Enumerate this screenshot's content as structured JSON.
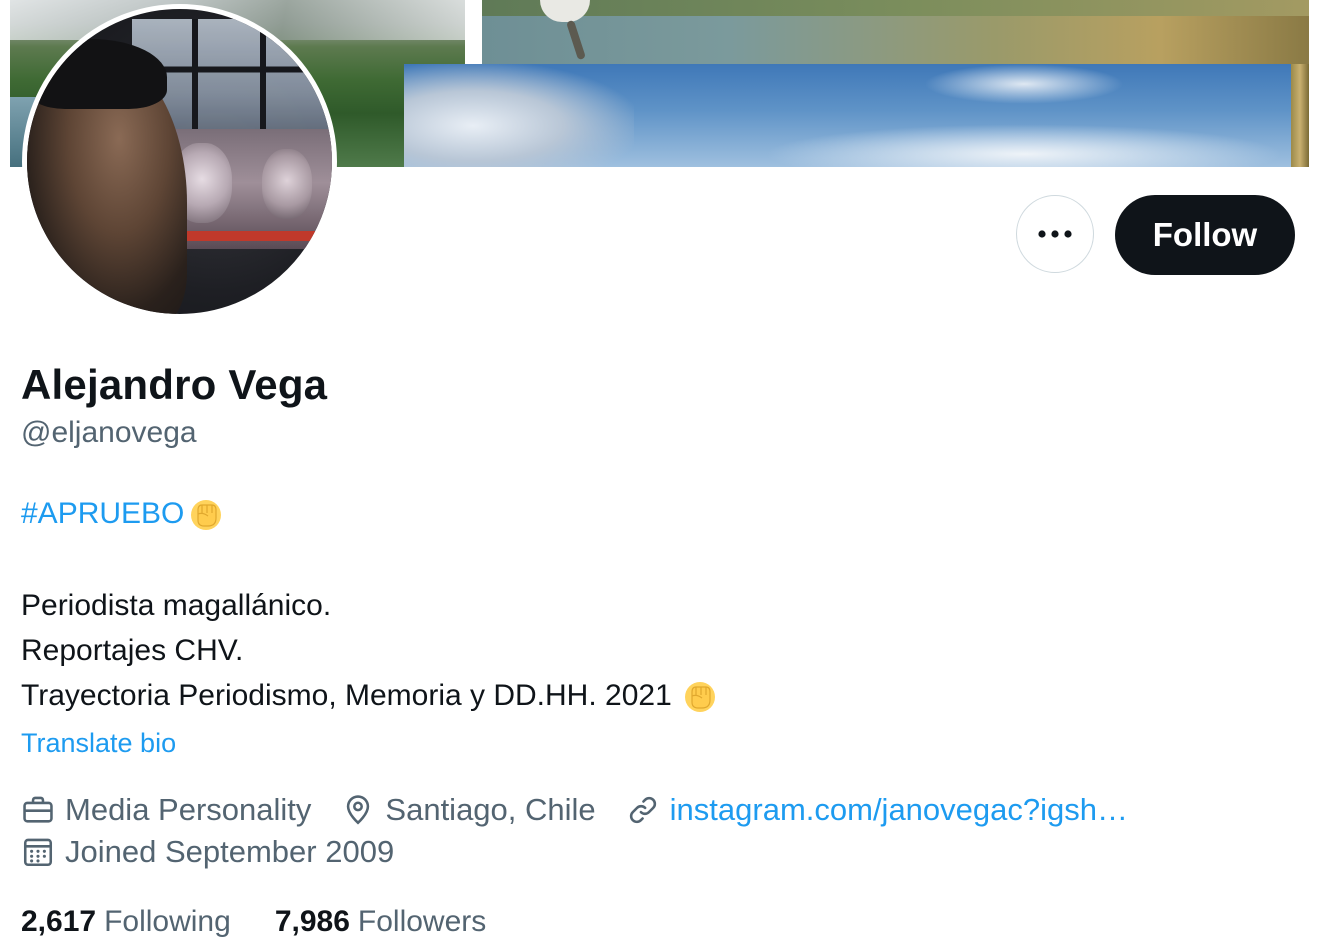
{
  "profile": {
    "display_name": "Alejandro Vega",
    "handle": "@eljanovega",
    "hashtag": "#APRUEBO",
    "bio_lines": [
      "Periodista magallánico.",
      "Reportajes CHV.",
      "Trayectoria Periodismo, Memoria y DD.HH. 2021"
    ],
    "translate_label": "Translate bio",
    "category": "Media Personality",
    "location": "Santiago, Chile",
    "website": "instagram.com/janovegac?igsh…",
    "joined": "Joined September 2009"
  },
  "actions": {
    "follow_label": "Follow",
    "more_icon": "more-horizontal-icon"
  },
  "stats": {
    "following_count": "2,617",
    "following_label": "Following",
    "followers_count": "7,986",
    "followers_label": "Followers"
  },
  "icons": {
    "category": "briefcase-icon",
    "location": "map-pin-icon",
    "website": "link-icon",
    "joined": "calendar-icon",
    "emoji": "raised-fist-emoji"
  },
  "colors": {
    "accent": "#1d9bf0",
    "primary_text": "#0f1419",
    "secondary_text": "#536471",
    "follow_button_bg": "#0f1419",
    "border": "#cfd9de"
  }
}
